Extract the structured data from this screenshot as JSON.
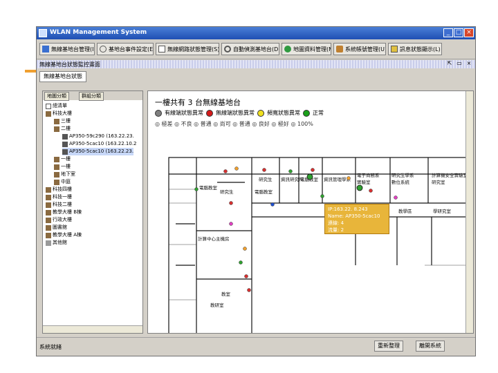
{
  "window": {
    "title": "WLAN Management System"
  },
  "toolbar": {
    "buttons": [
      {
        "label": "無線基地台管理(I)",
        "icon": "list-icon"
      },
      {
        "label": "基地台事件設定(E)",
        "icon": "clock-icon"
      },
      {
        "label": "無線網路狀態管理(S)",
        "icon": "document-icon"
      },
      {
        "label": "自動偵測基地台(D)",
        "icon": "search-icon"
      },
      {
        "label": "地圖資料管理(M)",
        "icon": "map-icon"
      },
      {
        "label": "系統帳號管理(U)",
        "icon": "users-icon"
      },
      {
        "label": "訊息狀態顯示(L)",
        "icon": "message-icon"
      }
    ]
  },
  "subbar": {
    "title": "無線基地台狀態監控畫面"
  },
  "tab": {
    "label": "無線基地台狀態"
  },
  "left_panel": {
    "tabs": [
      "地圖分類",
      "群組分類"
    ],
    "tree": [
      {
        "label": "總清單",
        "level": 0
      },
      {
        "label": "科技大樓",
        "level": 0
      },
      {
        "label": "三樓",
        "level": 1
      },
      {
        "label": "二樓",
        "level": 1
      },
      {
        "label": "AP350-59c290 (163.22.23.",
        "level": 2
      },
      {
        "label": "AP350-5cac10 (163.22.10.2",
        "level": 2
      },
      {
        "label": "AP350-5cac10 (163.22.23.",
        "level": 2
      },
      {
        "label": "一樓",
        "level": 1
      },
      {
        "label": "一樓",
        "level": 1
      },
      {
        "label": "地下室",
        "level": 1
      },
      {
        "label": "中庭",
        "level": 1
      },
      {
        "label": "科技四樓",
        "level": 0
      },
      {
        "label": "科技一樓",
        "level": 0
      },
      {
        "label": "科技二樓",
        "level": 0
      },
      {
        "label": "教學大樓 B棟",
        "level": 0
      },
      {
        "label": "行政大樓",
        "level": 0
      },
      {
        "label": "圖書館",
        "level": 0
      },
      {
        "label": "教學大樓 A棟",
        "level": 0
      },
      {
        "label": "其他館",
        "level": 0
      }
    ]
  },
  "map": {
    "title": "一樓共有 3 台無線基地台",
    "legend": [
      {
        "label": "有線端狀態異常",
        "color": "#7f7f7f"
      },
      {
        "label": "無線端狀態異常",
        "color": "#d41a1a"
      },
      {
        "label": "頻寬狀態異常",
        "color": "#f0e020"
      },
      {
        "label": "正常",
        "color": "#1aa01a"
      }
    ],
    "legend2": "◎ 極差  ◎ 不良  ◎ 普通  ◎ 尚可  ◎ 普通  ◎ 良好  ◎ 極好  ◎ 100%",
    "rooms": [
      "研究生",
      "研究生",
      "電腦教室",
      "資訊研究所",
      "電腦教室",
      "資訊管理學系",
      "電子商務系",
      "實驗室",
      "研究生學系",
      "數位系統",
      "計算機安全實驗室",
      "研究室",
      "教學區",
      "電腦教室",
      "計算中心主機房",
      "教室",
      "學研究室",
      "教研室"
    ],
    "popup": {
      "line1": "IP:163.22.  8.243",
      "line2": "Name: AP350-5cac10",
      "line3": "連線: 4",
      "line4": "流量: 2"
    }
  },
  "status": {
    "text": "系統就緒",
    "buttons": [
      "重新整理",
      "離開系統"
    ]
  },
  "colors": {
    "titlebar": "#1f4fb4",
    "popup": "#e8b53a",
    "accent_orange": "#f0a030"
  }
}
